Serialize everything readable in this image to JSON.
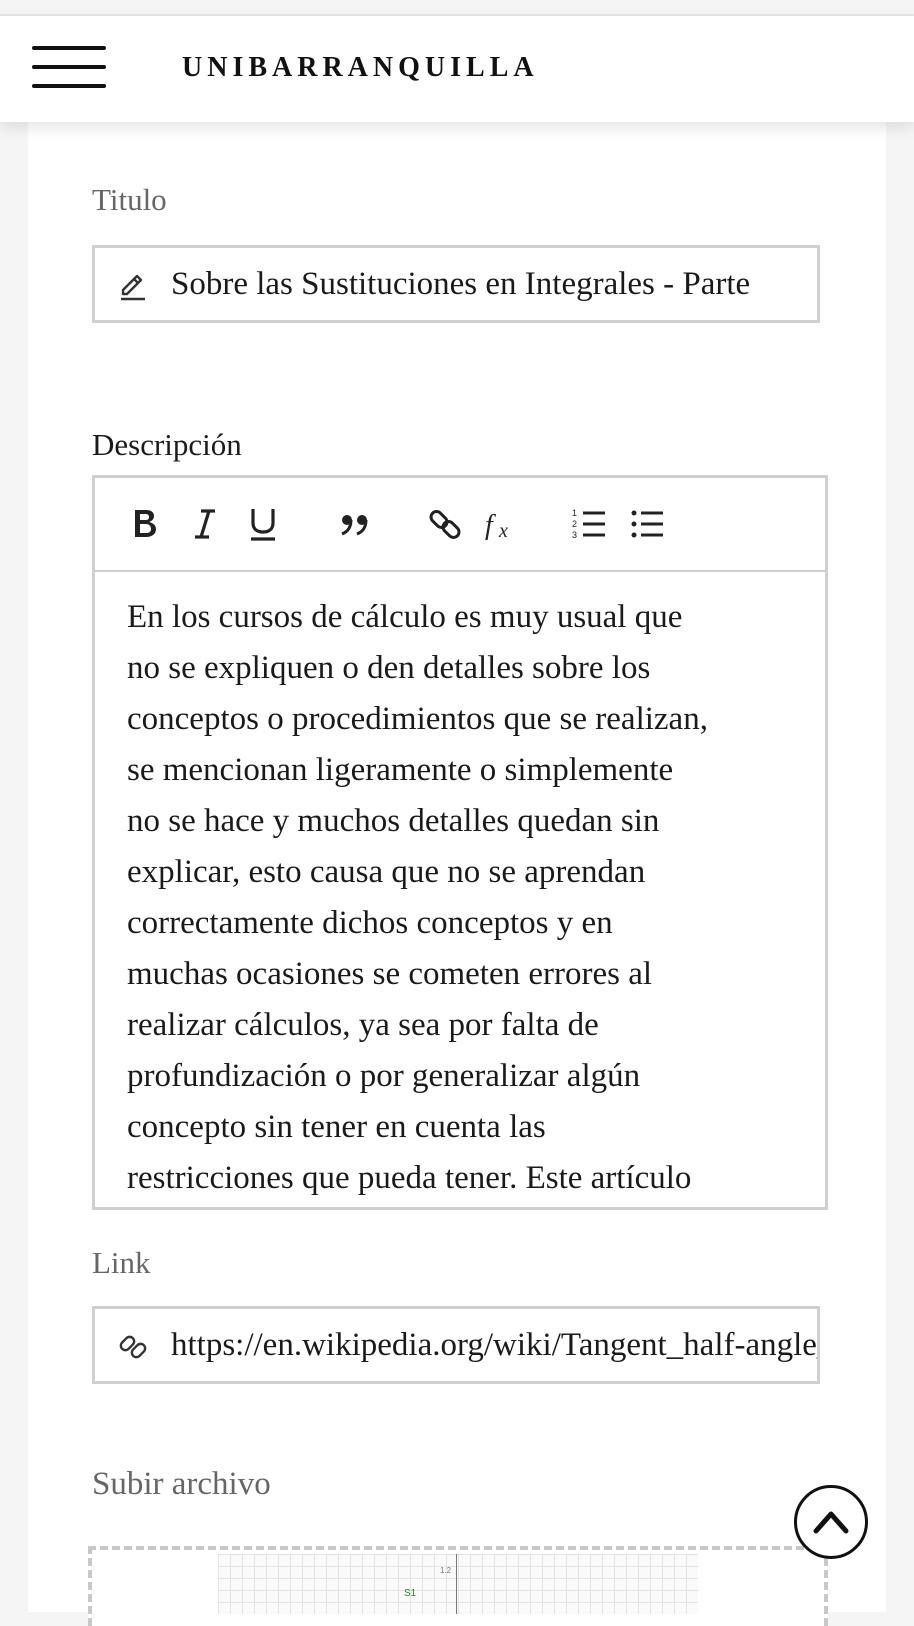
{
  "header": {
    "brand": "UNIBARRANQUILLA",
    "menu_icon": "hamburger-menu-icon"
  },
  "form": {
    "title": {
      "label": "Titulo",
      "value": "Sobre las Sustituciones en Integrales - Parte",
      "icon": "pencil-icon"
    },
    "description": {
      "label": "Descripción",
      "toolbar": [
        {
          "name": "bold",
          "icon": "bold-icon"
        },
        {
          "name": "italic",
          "icon": "italic-icon"
        },
        {
          "name": "underline",
          "icon": "underline-icon"
        },
        {
          "name": "blockquote",
          "icon": "quote-icon"
        },
        {
          "name": "link",
          "icon": "link-icon"
        },
        {
          "name": "formula",
          "icon": "formula-icon"
        },
        {
          "name": "ordered-list",
          "icon": "ordered-list-icon"
        },
        {
          "name": "bullet-list",
          "icon": "bullet-list-icon"
        }
      ],
      "lines": [
        "En los cursos de cálculo es muy usual que",
        "no se expliquen o den detalles sobre los",
        "conceptos o procedimientos que se realizan,",
        "se mencionan ligeramente o simplemente",
        "no se hace y muchos detalles quedan sin",
        "explicar, esto causa que no se aprendan",
        "correctamente dichos conceptos y en",
        "muchas ocasiones se cometen errores al",
        "realizar cálculos, ya sea por falta de",
        "profundización o por generalizar algún",
        "concepto sin tener en cuenta las",
        "restricciones que pueda tener. Este artículo"
      ]
    },
    "link": {
      "label": "Link",
      "value": "https://en.wikipedia.org/wiki/Tangent_half-angle_substitution",
      "icon": "link-icon"
    },
    "upload": {
      "label": "Subir archivo",
      "preview_axis_label": "1.2",
      "preview_series_label": "S1"
    }
  },
  "scroll_top": {
    "icon": "chevron-up-icon"
  },
  "colors": {
    "border": "#cfcfcf",
    "muted_label": "#666666",
    "text": "#1a1a1a"
  }
}
